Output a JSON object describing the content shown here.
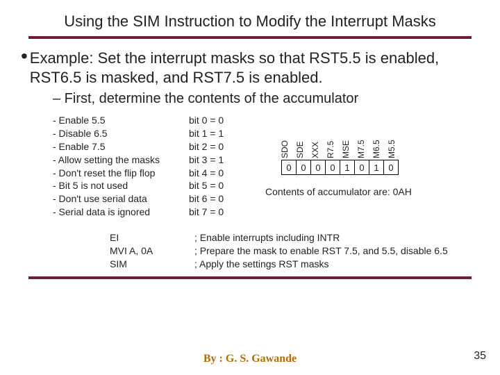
{
  "title": "Using the SIM Instruction to Modify the Interrupt Masks",
  "bullet": {
    "dot": "•",
    "text": "Example: Set the interrupt masks so that RST5.5 is enabled, RST6.5 is masked, and RST7.5 is enabled."
  },
  "sub_bullet": "–  First, determine the contents of the accumulator",
  "left_lines": [
    "- Enable 5.5",
    "- Disable 6.5",
    "- Enable 7.5",
    "- Allow setting the masks",
    "- Don't reset the flip flop",
    "- Bit 5 is not used",
    "- Don't use serial data",
    "- Serial data is ignored"
  ],
  "mid_lines": [
    "bit 0 = 0",
    "bit 1 = 1",
    "bit 2 = 0",
    "bit 3 = 1",
    "bit 4 = 0",
    "bit 5 = 0",
    "bit 6 = 0",
    "bit 7 = 0"
  ],
  "bit_labels": [
    "SDO",
    "SDE",
    "XXX",
    "R7.5",
    "MSE",
    "M7.5",
    "M6.5",
    "M5.5"
  ],
  "bit_values": [
    "0",
    "0",
    "0",
    "0",
    "1",
    "0",
    "1",
    "0"
  ],
  "acc_note": "Contents of accumulator are: 0AH",
  "code": {
    "ops": [
      "EI",
      "MVI A, 0A",
      "SIM"
    ],
    "cmts": [
      "; Enable interrupts including INTR",
      "; Prepare the mask to enable RST 7.5, and 5.5, disable 6.5",
      "; Apply the settings RST masks"
    ]
  },
  "byline": "By :  G. S. Gawande",
  "page": "35"
}
